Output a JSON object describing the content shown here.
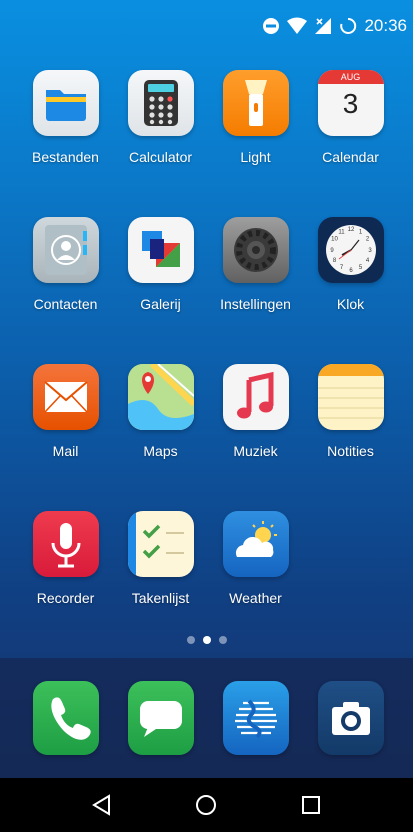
{
  "status_bar": {
    "time": "20:36",
    "icons": [
      "do-not-disturb-icon",
      "wifi-icon",
      "no-signal-icon",
      "sync-icon"
    ]
  },
  "apps": [
    {
      "label": "Bestanden",
      "icon": "folder-icon"
    },
    {
      "label": "Calculator",
      "icon": "calculator-icon"
    },
    {
      "label": "Light",
      "icon": "flashlight-icon"
    },
    {
      "label": "Calendar",
      "icon": "calendar-icon",
      "month": "AUG",
      "day": "3"
    },
    {
      "label": "Contacten",
      "icon": "contacts-icon"
    },
    {
      "label": "Galerij",
      "icon": "gallery-icon"
    },
    {
      "label": "Instellingen",
      "icon": "settings-gear-icon"
    },
    {
      "label": "Klok",
      "icon": "clock-icon",
      "numbers": [
        "12",
        "1",
        "2",
        "3",
        "4",
        "5",
        "6",
        "7",
        "8",
        "9",
        "10",
        "11"
      ]
    },
    {
      "label": "Mail",
      "icon": "mail-icon"
    },
    {
      "label": "Maps",
      "icon": "maps-icon"
    },
    {
      "label": "Muziek",
      "icon": "music-icon"
    },
    {
      "label": "Notities",
      "icon": "notes-icon"
    },
    {
      "label": "Recorder",
      "icon": "microphone-icon"
    },
    {
      "label": "Takenlijst",
      "icon": "checklist-icon"
    },
    {
      "label": "Weather",
      "icon": "weather-icon"
    }
  ],
  "page_indicator": {
    "pages": 3,
    "current": 2
  },
  "dock": [
    {
      "icon": "phone-icon"
    },
    {
      "icon": "messages-icon"
    },
    {
      "icon": "browser-icon"
    },
    {
      "icon": "camera-icon"
    }
  ],
  "nav_bar": [
    "back-icon",
    "home-icon",
    "recents-icon"
  ],
  "colors": {
    "background_top": "#0a8fe0",
    "background_bottom": "#1a2f63",
    "nav_bar": "#000000"
  }
}
